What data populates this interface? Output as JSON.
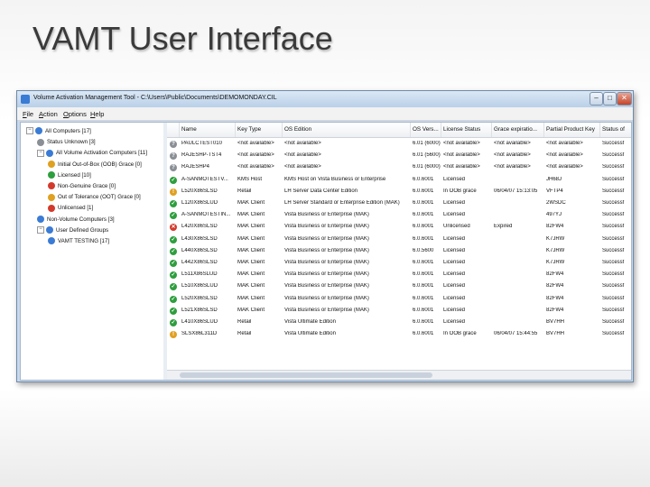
{
  "slide": {
    "title": "VAMT User Interface"
  },
  "window": {
    "title": "Volume Activation Management Tool - C:\\Users\\Public\\Documents\\DEMOMONDAY.CIL",
    "controls": {
      "minimize": "–",
      "maximize": "□",
      "close": "✕"
    }
  },
  "menu": [
    "File",
    "Action",
    "Options",
    "Help"
  ],
  "tree": [
    {
      "label": "All Computers [17]",
      "icon": "computers-icon",
      "color": "#3a7bd5"
    },
    {
      "label": "Status Unknown [3]",
      "icon": "question-icon",
      "color": "#8a8f96"
    },
    {
      "label": "All Volume Activation Computers [11]",
      "icon": "computers-icon",
      "color": "#3a7bd5"
    },
    {
      "label": "Initial Out-of-Box (OOB) Grace [0]",
      "icon": "warning-icon",
      "color": "#e0a020"
    },
    {
      "label": "Licensed [10]",
      "icon": "check-icon",
      "color": "#2e9e3e"
    },
    {
      "label": "Non-Genuine Grace [0]",
      "icon": "error-icon",
      "color": "#d33a2c"
    },
    {
      "label": "Out of Tolerance (OOT) Grace [0]",
      "icon": "warning-icon",
      "color": "#e0a020"
    },
    {
      "label": "Unlicensed [1]",
      "icon": "error-icon",
      "color": "#d33a2c"
    },
    {
      "label": "Non-Volume Computers [3]",
      "icon": "computers-icon",
      "color": "#3a7bd5"
    },
    {
      "label": "User Defined Groups",
      "icon": "folder-icon",
      "color": "#3a7bd5"
    },
    {
      "label": "VAMT TESTING [17]",
      "icon": "computers-icon",
      "color": "#3a7bd5"
    }
  ],
  "columns": [
    "Name",
    "Key Type",
    "OS Edition",
    "OS Vers...",
    "License Status",
    "Grace expiratio...",
    "Partial Product Key",
    "Status of"
  ],
  "rows": [
    {
      "icon": "question-icon",
      "color": "#8a8f96",
      "cells": [
        "PAULCTEST010",
        "<not available>",
        "<not available>",
        "6.01 (6000)",
        "<not available>",
        "<not available>",
        "<not available>",
        "Successf"
      ]
    },
    {
      "icon": "question-icon",
      "color": "#8a8f96",
      "cells": [
        "RAJESHP-TST4",
        "<not available>",
        "<not available>",
        "6.01 (5600)",
        "<not available>",
        "<not available>",
        "<not available>",
        "Successf"
      ]
    },
    {
      "icon": "question-icon",
      "color": "#8a8f96",
      "cells": [
        "RAJESHP4",
        "<not available>",
        "<not available>",
        "6.01 (6000)",
        "<not available>",
        "<not available>",
        "<not available>",
        "Successf"
      ]
    },
    {
      "icon": "check-icon",
      "color": "#2e9e3e",
      "cells": [
        "A-SANMOTESTV...",
        "KMS Host",
        "KMS Host on Vista Business or Enterprise",
        "6.0.6001",
        "Licensed",
        "",
        "JH68J",
        "Successf"
      ]
    },
    {
      "icon": "warning-icon",
      "color": "#e0a020",
      "cells": [
        "L520X86SLSD",
        "Retail",
        "LH Server Data Center Edition",
        "6.0.6001",
        "In OOB grace",
        "06/04/07 15:13:05",
        "VFTP4",
        "Successf"
      ]
    },
    {
      "icon": "check-icon",
      "color": "#2e9e3e",
      "cells": [
        "L120X86SLUD",
        "MAK Client",
        "LH Server Standard or Enterprise Edition (MAK)",
        "6.0.6001",
        "Licensed",
        "",
        "2WSDC",
        "Successf"
      ]
    },
    {
      "icon": "check-icon",
      "color": "#2e9e3e",
      "cells": [
        "A-SANMOTESTIN...",
        "MAK Client",
        "Vista Business or Enterprise (MAK)",
        "6.0.6001",
        "Licensed",
        "",
        "497YJ",
        "Successf"
      ]
    },
    {
      "icon": "error-icon",
      "color": "#d33a2c",
      "cells": [
        "L420X86SLSD",
        "MAK Client",
        "Vista Business or Enterprise (MAK)",
        "6.0.6001",
        "Unlicensed",
        "Expired",
        "82FW4",
        "Successf"
      ]
    },
    {
      "icon": "check-icon",
      "color": "#2e9e3e",
      "cells": [
        "L430X86SLSD",
        "MAK Client",
        "Vista Business or Enterprise (MAK)",
        "6.0.6001",
        "Licensed",
        "",
        "K7JRW",
        "Successf"
      ]
    },
    {
      "icon": "check-icon",
      "color": "#2e9e3e",
      "cells": [
        "L440X86SLSD",
        "MAK Client",
        "Vista Business or Enterprise (MAK)",
        "6.0.5600",
        "Licensed",
        "",
        "K7JRW",
        "Successf"
      ]
    },
    {
      "icon": "check-icon",
      "color": "#2e9e3e",
      "cells": [
        "L442X86SLSD",
        "MAK Client",
        "Vista Business or Enterprise (MAK)",
        "6.0.6001",
        "Licensed",
        "",
        "K7JRW",
        "Successf"
      ]
    },
    {
      "icon": "check-icon",
      "color": "#2e9e3e",
      "cells": [
        "L511X86SLUD",
        "MAK Client",
        "Vista Business or Enterprise (MAK)",
        "6.0.6001",
        "Licensed",
        "",
        "82FW4",
        "Successf"
      ]
    },
    {
      "icon": "check-icon",
      "color": "#2e9e3e",
      "cells": [
        "L510X86SLUD",
        "MAK Client",
        "Vista Business or Enterprise (MAK)",
        "6.0.6001",
        "Licensed",
        "",
        "82FW4",
        "Successf"
      ]
    },
    {
      "icon": "check-icon",
      "color": "#2e9e3e",
      "cells": [
        "L520X86SLSD",
        "MAK Client",
        "Vista Business or Enterprise (MAK)",
        "6.0.6001",
        "Licensed",
        "",
        "82FW4",
        "Successf"
      ]
    },
    {
      "icon": "check-icon",
      "color": "#2e9e3e",
      "cells": [
        "L521X86SLSD",
        "MAK Client",
        "Vista Business or Enterprise (MAK)",
        "6.0.6001",
        "Licensed",
        "",
        "82FW4",
        "Successf"
      ]
    },
    {
      "icon": "check-icon",
      "color": "#2e9e3e",
      "cells": [
        "L410X86SLUD",
        "Retail",
        "Vista Ultimate Edition",
        "6.0.6001",
        "Licensed",
        "",
        "BV7HH",
        "Successf"
      ]
    },
    {
      "icon": "warning-icon",
      "color": "#e0a020",
      "cells": [
        "SLSX86L311D",
        "Retail",
        "Vista Ultimate Edition",
        "6.0.6001",
        "In OOB grace",
        "06/04/07 15:44:55",
        "BV7HH",
        "Successf"
      ]
    }
  ]
}
